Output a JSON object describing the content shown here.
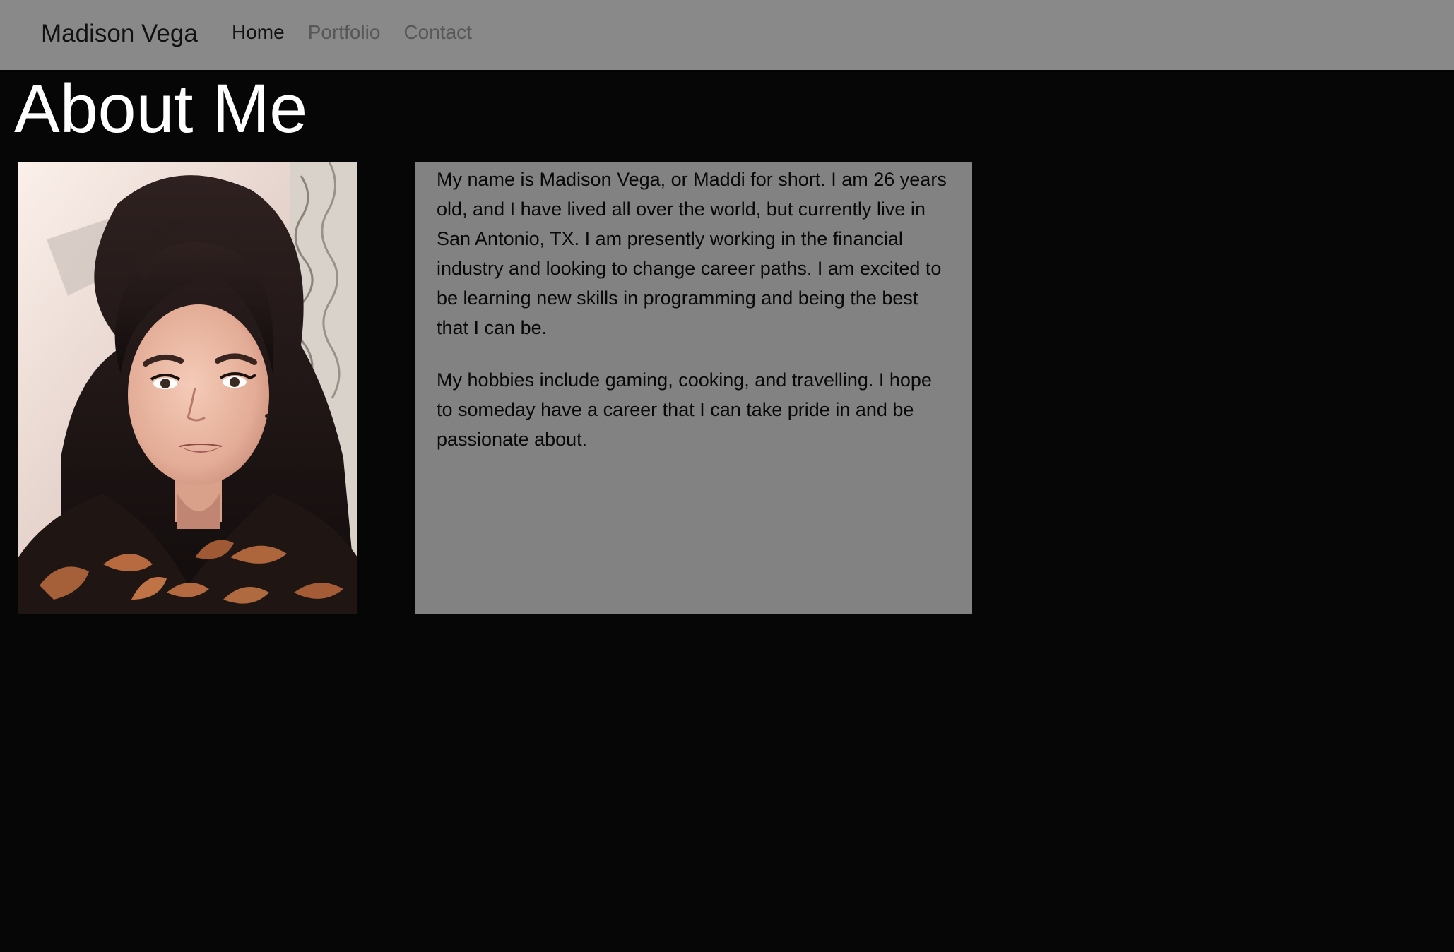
{
  "nav": {
    "brand": "Madison Vega",
    "links": [
      {
        "label": "Home",
        "active": true
      },
      {
        "label": "Portfolio",
        "active": false
      },
      {
        "label": "Contact",
        "active": false
      }
    ]
  },
  "main": {
    "title": "About Me",
    "photo_alt": "Portrait of Madison Vega",
    "paragraphs": [
      "My name is Madison Vega, or Maddi for short. I am 26 years old, and I have lived all over the world, but currently live in San Antonio, TX. I am presently working in the financial industry and looking to change career paths. I am excited to be learning new skills in programming and being the best that I can be.",
      "My hobbies include gaming, cooking, and travelling. I hope to someday have a career that I can take pride in and be passionate about."
    ]
  },
  "colors": {
    "page_background": "#060606",
    "navbar_background": "#898989",
    "about_box_background": "#828282",
    "title_text": "#ffffff"
  }
}
